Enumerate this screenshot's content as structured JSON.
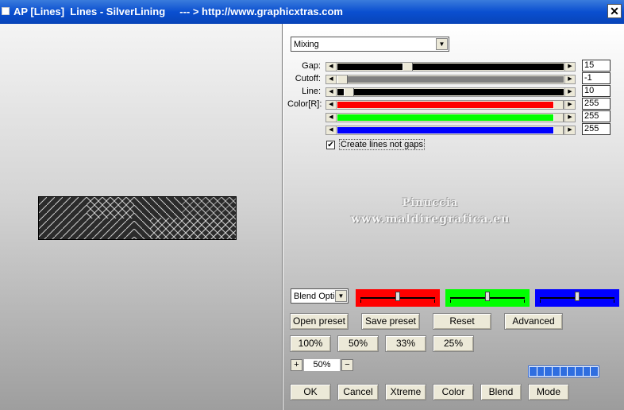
{
  "window": {
    "title": "AP [Lines]  Lines - SilverLining     --- > http://www.graphicxtras.com",
    "close_label": "✕"
  },
  "mode_select": {
    "value": "Mixing"
  },
  "sliders": [
    {
      "label": "Gap:",
      "value": "15",
      "track_color": "#000000",
      "level": 0.3
    },
    {
      "label": "Cutoff:",
      "value": "-1",
      "track_color": "#808080",
      "level": 0.0
    },
    {
      "label": "Line:",
      "value": "10",
      "track_color": "#000000",
      "level": 0.03
    },
    {
      "label": "Color[R]:",
      "value": "255",
      "track_color": "#ff0000",
      "level": 1.0
    },
    {
      "label": "",
      "value": "255",
      "track_color": "#00ff00",
      "level": 1.0
    },
    {
      "label": "",
      "value": "255",
      "track_color": "#0000ff",
      "level": 1.0
    }
  ],
  "checkbox": {
    "label": "Create lines not gaps",
    "checked": true,
    "mark": "✔"
  },
  "watermark": {
    "line1": "Pinuccia",
    "line2": "www.maldiregrafica.eu"
  },
  "blend_select": {
    "value": "Blend Optio"
  },
  "blend_blocks": [
    {
      "color": "#ff0000",
      "level": 0.5
    },
    {
      "color": "#00ff00",
      "level": 0.5
    },
    {
      "color": "#0000ff",
      "level": 0.5
    }
  ],
  "preset_buttons": {
    "open": "Open preset",
    "save": "Save preset",
    "reset": "Reset",
    "advanced": "Advanced"
  },
  "percent_buttons": [
    "100%",
    "50%",
    "33%",
    "25%"
  ],
  "zoom": {
    "plus": "+",
    "value": "50%",
    "minus": "−"
  },
  "bottom_buttons": {
    "ok": "OK",
    "cancel": "Cancel",
    "xtreme": "Xtreme",
    "color": "Color",
    "blend": "Blend",
    "mode": "Mode"
  },
  "progress": {
    "segments": 9
  }
}
